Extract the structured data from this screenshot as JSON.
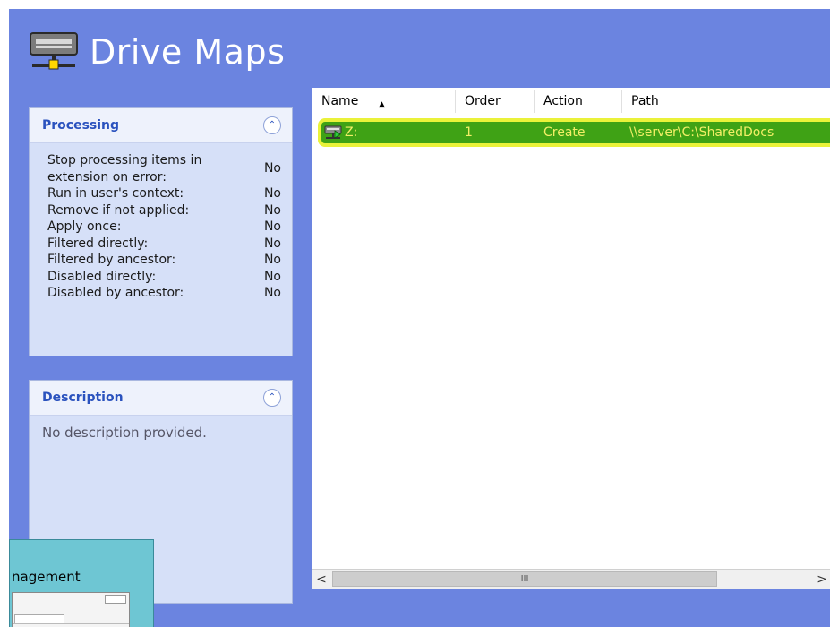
{
  "header": {
    "title": "Drive Maps",
    "icon": "network-drive-icon"
  },
  "processing": {
    "title": "Processing",
    "collapse_icon": "double-chevron-up-icon",
    "properties": [
      {
        "label": "Stop processing items in extension on error:",
        "value": "No"
      },
      {
        "label": "Run in user's context:",
        "value": "No"
      },
      {
        "label": "Remove if not applied:",
        "value": "No"
      },
      {
        "label": "Apply once:",
        "value": "No"
      },
      {
        "label": "Filtered directly:",
        "value": "No"
      },
      {
        "label": "Filtered by ancestor:",
        "value": "No"
      },
      {
        "label": "Disabled directly:",
        "value": "No"
      },
      {
        "label": "Disabled by ancestor:",
        "value": "No"
      }
    ]
  },
  "description": {
    "title": "Description",
    "collapse_icon": "double-chevron-up-icon",
    "text": "No description provided."
  },
  "list": {
    "columns": [
      "Name",
      "Order",
      "Action",
      "Path"
    ],
    "sorted_column": "Name",
    "rows": [
      {
        "name": "Z:",
        "order": "1",
        "action": "Create",
        "path": "\\\\server\\C:\\SharedDocs",
        "icon": "mapped-drive-icon"
      }
    ],
    "scrollbar": {
      "left": "<",
      "thumb": "III",
      "right": ">"
    }
  },
  "overlay": {
    "title": "nagement"
  },
  "colors": {
    "background": "#6b84e0",
    "panel": "#d6e0f8",
    "panel_title": "#2a52be",
    "row_highlight": "#3fa215",
    "row_marker": "#eaf23a",
    "row_text": "#f3ef66"
  }
}
